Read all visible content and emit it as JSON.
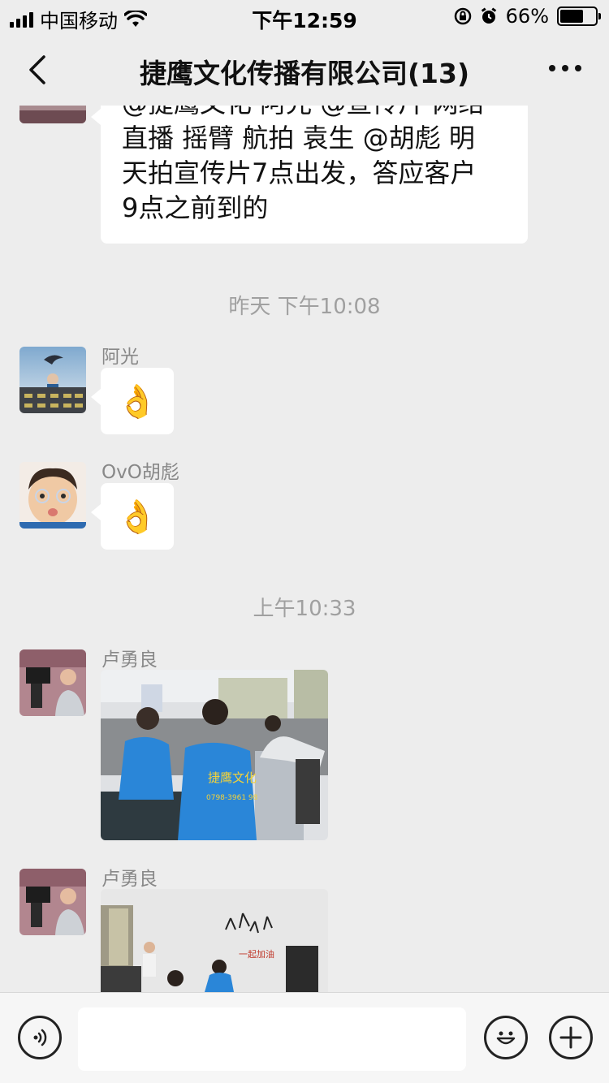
{
  "status_bar": {
    "carrier": "中国移动",
    "time": "下午12:59",
    "battery": "66%",
    "battery_level": 0.66
  },
  "nav": {
    "title": "捷鹰文化传播有限公司(13)"
  },
  "messages": {
    "first_text": {
      "lines": [
        "@捷鹰文化  阿光 @宣传片 网络",
        "直播  摇臂  航拍   袁生 @胡彪 明",
        "天拍宣传片7点出发，答应客户",
        "9点之前到的"
      ]
    },
    "timestamp_1": "昨天 下午10:08",
    "msg_aguang": {
      "sender": "阿光",
      "content": "👌"
    },
    "msg_hubiao": {
      "sender": "OvO胡彪",
      "content": "👌"
    },
    "timestamp_2": "上午10:33",
    "msg_lu_1": {
      "sender": "卢勇良"
    },
    "msg_lu_2": {
      "sender": "卢勇良"
    }
  },
  "photo_text": {
    "shirt_line1": "捷鹰文化",
    "shirt_line2": "0798-3961 98",
    "wall_text": "一起加油"
  },
  "icons": {
    "back": "chevron-left-icon",
    "more": "more-dots-icon",
    "voice": "voice-icon",
    "emoji": "emoji-icon",
    "add": "plus-icon"
  },
  "colors": {
    "background": "#ededed",
    "bubble": "#ffffff",
    "timestamp": "#a0a0a0",
    "sender": "#888888",
    "shirt_blue": "#2a86d8",
    "shirt_text": "#f3d23a"
  }
}
